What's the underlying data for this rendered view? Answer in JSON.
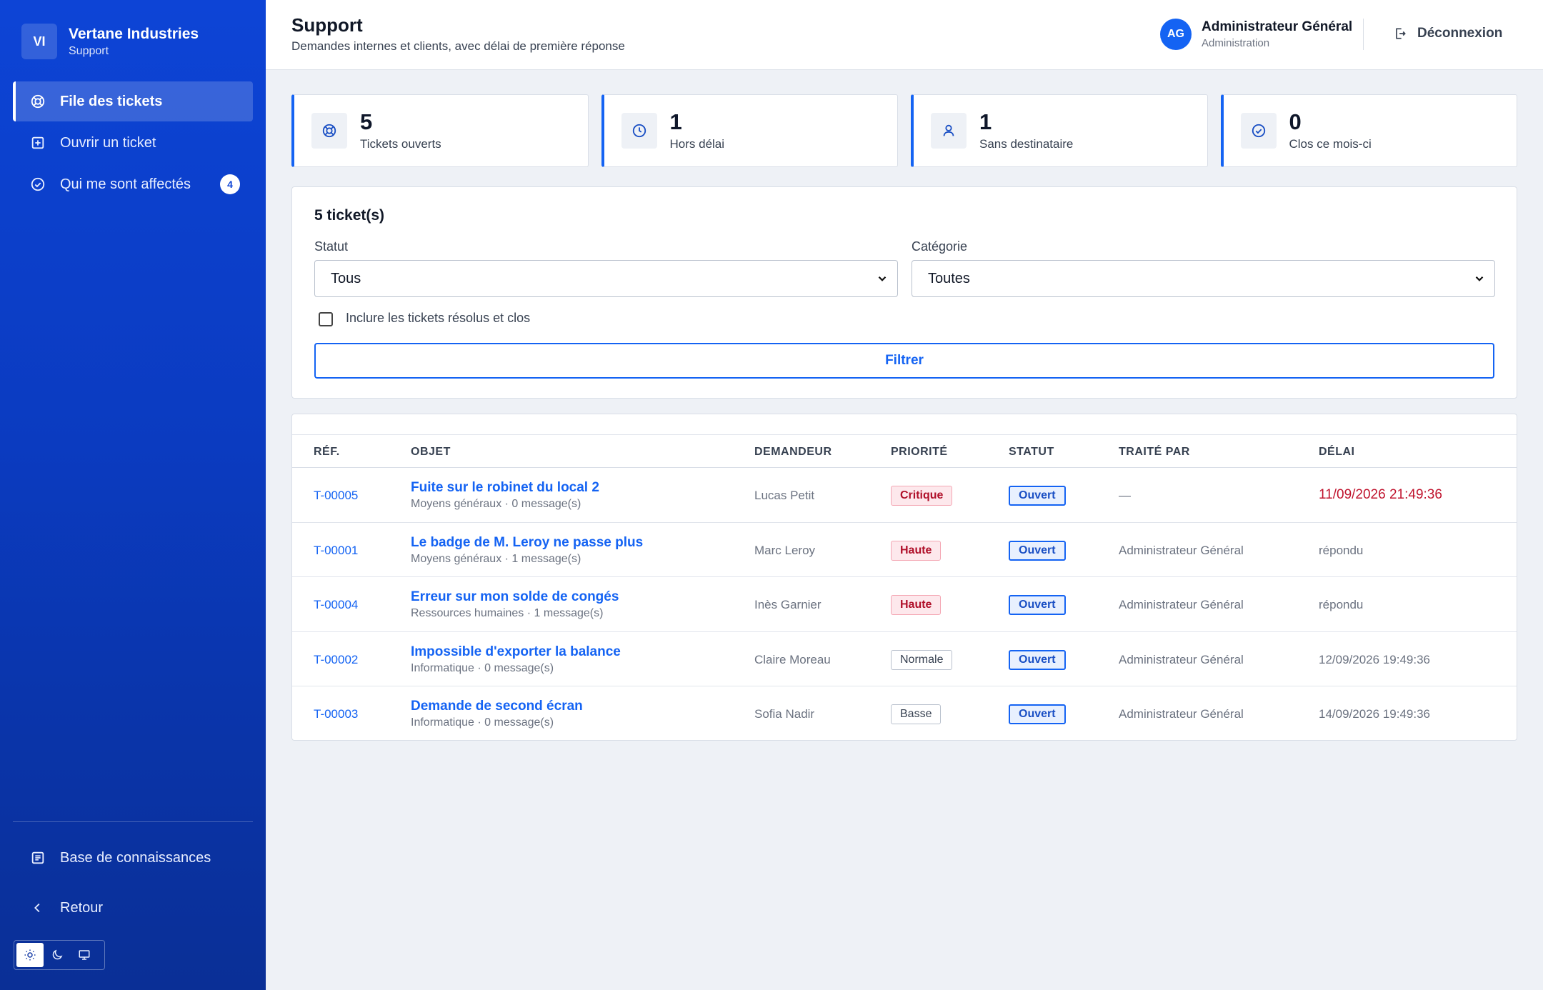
{
  "brand": {
    "initials": "VI",
    "name": "Vertane Industries",
    "sub": "Support"
  },
  "sidebar": {
    "items": [
      {
        "label": "File des tickets",
        "icon": "lifebuoy-icon",
        "active": true
      },
      {
        "label": "Ouvrir un ticket",
        "icon": "plus-square-icon"
      },
      {
        "label": "Qui me sont affectés",
        "icon": "check-circle-icon",
        "badge": "4"
      }
    ],
    "bottom": [
      {
        "label": "Base de connaissances",
        "icon": "document-icon"
      },
      {
        "label": "Retour",
        "icon": "chevron-left-icon"
      }
    ],
    "theme": {
      "options": [
        "sun-icon",
        "moon-icon",
        "monitor-icon"
      ],
      "active": "sun-icon"
    }
  },
  "header": {
    "title": "Support",
    "subtitle": "Demandes internes et clients, avec délai de première réponse",
    "user": {
      "initials": "AG",
      "name": "Administrateur Général",
      "role": "Administration"
    },
    "logout": "Déconnexion"
  },
  "stats": [
    {
      "value": "5",
      "label": "Tickets ouverts",
      "icon": "lifebuoy-icon"
    },
    {
      "value": "1",
      "label": "Hors délai",
      "icon": "clock-icon"
    },
    {
      "value": "1",
      "label": "Sans destinataire",
      "icon": "user-icon"
    },
    {
      "value": "0",
      "label": "Clos ce mois-ci",
      "icon": "check-circle-icon"
    }
  ],
  "filters": {
    "count": "5 ticket(s)",
    "status_label": "Statut",
    "status_value": "Tous",
    "category_label": "Catégorie",
    "category_value": "Toutes",
    "include_closed": "Inclure les tickets résolus et clos",
    "submit": "Filtrer"
  },
  "table": {
    "columns": [
      "RÉF.",
      "OBJET",
      "DEMANDEUR",
      "PRIORITÉ",
      "STATUT",
      "TRAITÉ PAR",
      "DÉLAI"
    ],
    "rows": [
      {
        "ref": "T-00005",
        "title": "Fuite sur le robinet du local 2",
        "sub": "Moyens généraux · 0 message(s)",
        "requester": "Lucas Petit",
        "priority": "Critique",
        "status": "Ouvert",
        "agent": "—",
        "delay": "11/09/2026 21:49:36"
      },
      {
        "ref": "T-00001",
        "title": "Le badge de M. Leroy ne passe plus",
        "sub": "Moyens généraux · 1 message(s)",
        "requester": "Marc Leroy",
        "priority": "Haute",
        "status": "Ouvert",
        "agent": "Administrateur Général",
        "delay": "répondu"
      },
      {
        "ref": "T-00004",
        "title": "Erreur sur mon solde de congés",
        "sub": "Ressources humaines · 1 message(s)",
        "requester": "Inès Garnier",
        "priority": "Haute",
        "status": "Ouvert",
        "agent": "Administrateur Général",
        "delay": "répondu"
      },
      {
        "ref": "T-00002",
        "title": "Impossible d'exporter la balance",
        "sub": "Informatique · 0 message(s)",
        "requester": "Claire Moreau",
        "priority": "Normale",
        "status": "Ouvert",
        "agent": "Administrateur Général",
        "delay": "12/09/2026 19:49:36"
      },
      {
        "ref": "T-00003",
        "title": "Demande de second écran",
        "sub": "Informatique · 0 message(s)",
        "requester": "Sofia Nadir",
        "priority": "Basse",
        "status": "Ouvert",
        "agent": "Administrateur Général",
        "delay": "14/09/2026 19:49:36"
      }
    ]
  },
  "colors": {
    "accent": "#1463f3",
    "sidebar": "#0b3bc0",
    "danger": "#c0142e"
  }
}
